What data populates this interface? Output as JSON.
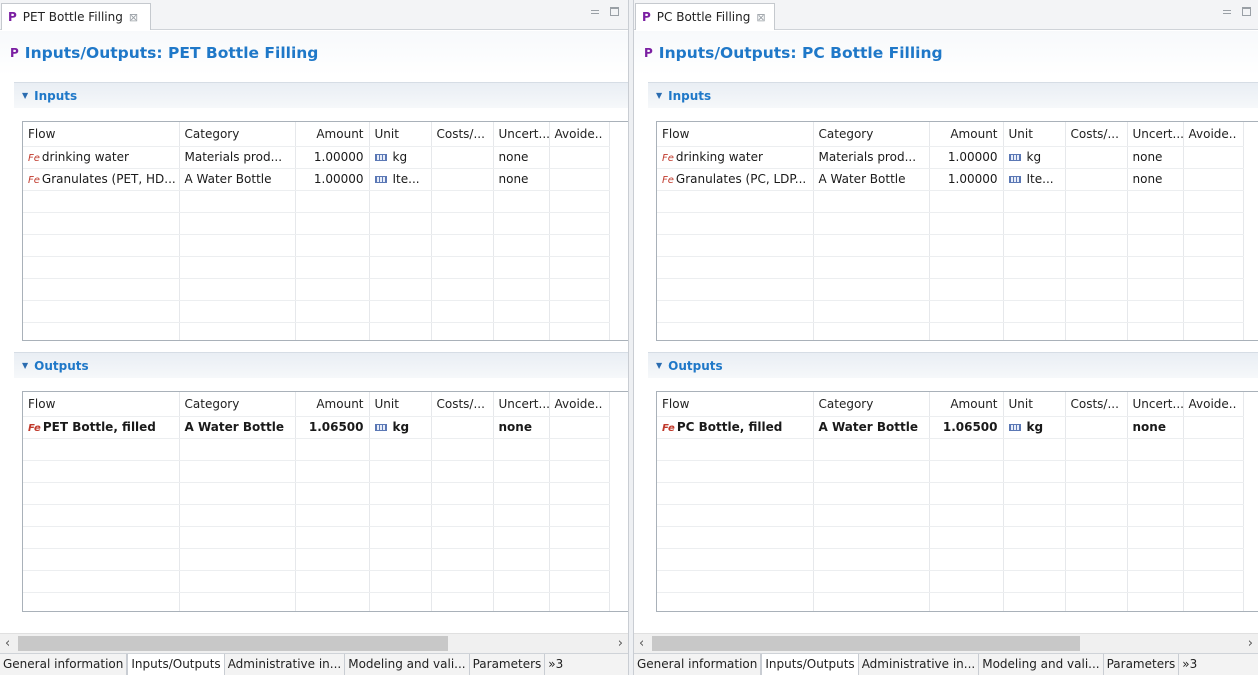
{
  "left": {
    "tab_title": "PET Bottle Filling",
    "form_title": "Inputs/Outputs: PET Bottle Filling",
    "inputs_title": "Inputs",
    "outputs_title": "Outputs",
    "columns": [
      "Flow",
      "Category",
      "Amount",
      "Unit",
      "Costs/...",
      "Uncert...",
      "Avoide.."
    ],
    "inputs": [
      {
        "flow": "drinking water",
        "category": "Materials prod...",
        "amount": "1.00000",
        "unit": "kg",
        "costs": "",
        "uncertainty": "none",
        "avoided": ""
      },
      {
        "flow": "Granulates (PET, HD...",
        "category": "A Water Bottle",
        "amount": "1.00000",
        "unit": "Ite...",
        "costs": "",
        "uncertainty": "none",
        "avoided": ""
      }
    ],
    "outputs": [
      {
        "flow": "PET Bottle, filled",
        "category": "A Water Bottle",
        "amount": "1.06500",
        "unit": "kg",
        "costs": "",
        "uncertainty": "none",
        "avoided": ""
      }
    ]
  },
  "right": {
    "tab_title": "PC Bottle Filling",
    "form_title": "Inputs/Outputs: PC Bottle Filling",
    "inputs_title": "Inputs",
    "outputs_title": "Outputs",
    "columns": [
      "Flow",
      "Category",
      "Amount",
      "Unit",
      "Costs/...",
      "Uncert...",
      "Avoide.."
    ],
    "inputs": [
      {
        "flow": "drinking water",
        "category": "Materials prod...",
        "amount": "1.00000",
        "unit": "kg",
        "costs": "",
        "uncertainty": "none",
        "avoided": ""
      },
      {
        "flow": "Granulates (PC, LDP...",
        "category": "A Water Bottle",
        "amount": "1.00000",
        "unit": "Ite...",
        "costs": "",
        "uncertainty": "none",
        "avoided": ""
      }
    ],
    "outputs": [
      {
        "flow": "PC Bottle, filled",
        "category": "A Water Bottle",
        "amount": "1.06500",
        "unit": "kg",
        "costs": "",
        "uncertainty": "none",
        "avoided": ""
      }
    ]
  },
  "page_tabs": [
    "General information",
    "Inputs/Outputs",
    "Administrative in...",
    "Modeling and vali...",
    "Parameters"
  ],
  "page_tabs_more": "»3",
  "icons": {
    "process": "P",
    "flow": "Fe",
    "tab_close": "⊠",
    "section_toggle": "▼"
  },
  "colors": {
    "title_blue": "#1f78c8",
    "process_purple": "#7b1fa2"
  }
}
